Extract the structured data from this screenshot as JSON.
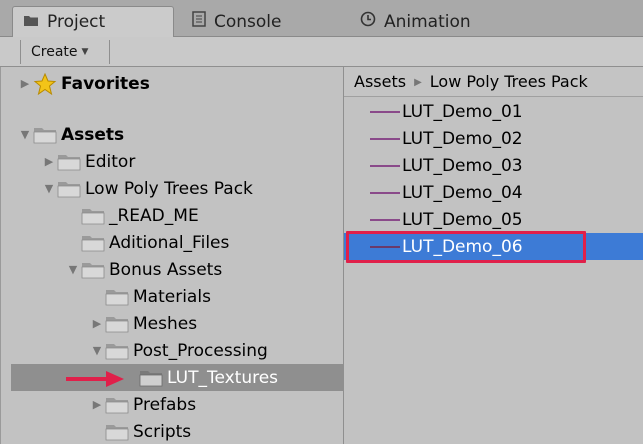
{
  "tabs": [
    {
      "label": "Project",
      "icon": "folder-tab-icon"
    },
    {
      "label": "Console",
      "icon": "console-icon"
    },
    {
      "label": "Animation",
      "icon": "clock-icon"
    }
  ],
  "toolbar": {
    "create_label": "Create"
  },
  "breadcrumb": {
    "root": "Assets",
    "current": "Low Poly Trees Pack"
  },
  "tree": [
    {
      "label": "Favorites",
      "depth": 0,
      "foldout": "collapsed",
      "icon": "star-icon",
      "bold": true
    },
    {
      "label": "Assets",
      "depth": 0,
      "foldout": "expanded",
      "icon": "folder-icon",
      "bold": true
    },
    {
      "label": "Editor",
      "depth": 1,
      "foldout": "collapsed",
      "icon": "folder-icon"
    },
    {
      "label": "Low Poly Trees Pack",
      "depth": 1,
      "foldout": "expanded",
      "icon": "folder-icon"
    },
    {
      "label": "_READ_ME",
      "depth": 2,
      "foldout": "none",
      "icon": "folder-icon"
    },
    {
      "label": "Aditional_Files",
      "depth": 2,
      "foldout": "none",
      "icon": "folder-icon"
    },
    {
      "label": "Bonus Assets",
      "depth": 2,
      "foldout": "expanded",
      "icon": "folder-icon"
    },
    {
      "label": "Materials",
      "depth": 3,
      "foldout": "none",
      "icon": "folder-icon"
    },
    {
      "label": "Meshes",
      "depth": 3,
      "foldout": "collapsed",
      "icon": "folder-icon"
    },
    {
      "label": "Post_Processing",
      "depth": 3,
      "foldout": "expanded",
      "icon": "folder-icon"
    },
    {
      "label": "LUT_Textures",
      "depth": 4,
      "foldout": "none",
      "icon": "folder-icon",
      "selected": true
    },
    {
      "label": "Prefabs",
      "depth": 3,
      "foldout": "collapsed",
      "icon": "folder-icon"
    },
    {
      "label": "Scripts",
      "depth": 3,
      "foldout": "none",
      "icon": "folder-icon"
    }
  ],
  "files": [
    {
      "label": "LUT_Demo_01"
    },
    {
      "label": "LUT_Demo_02"
    },
    {
      "label": "LUT_Demo_03"
    },
    {
      "label": "LUT_Demo_04"
    },
    {
      "label": "LUT_Demo_05"
    },
    {
      "label": "LUT_Demo_06",
      "selected": true
    }
  ],
  "colors": {
    "selection_blue": "#3d7bd6",
    "annotation_red": "#e0204a",
    "tree_selected": "#8f8f8f"
  }
}
